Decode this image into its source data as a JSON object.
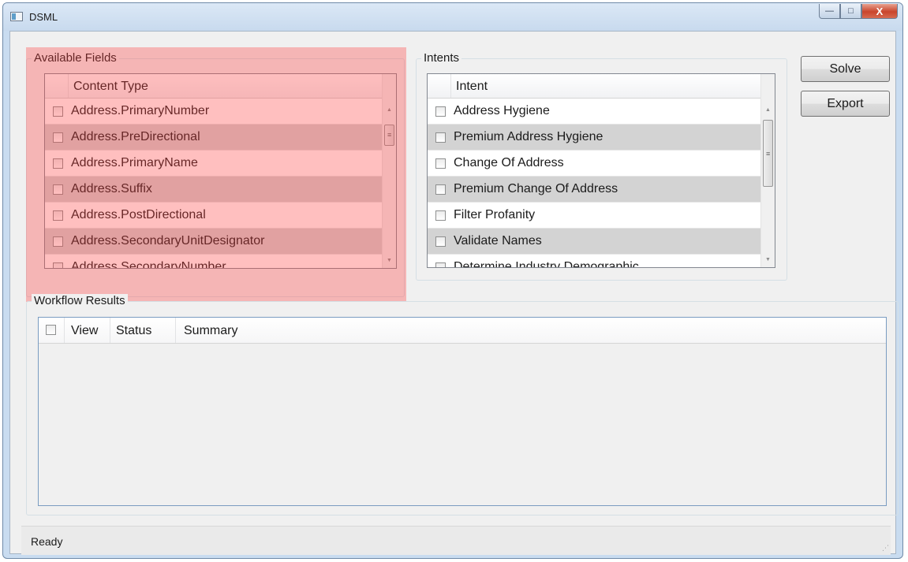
{
  "window": {
    "title": "DSML",
    "controls": {
      "minimize": "—",
      "maximize": "□",
      "close": "X"
    }
  },
  "available_fields": {
    "group_label": "Available Fields",
    "column_header": "Content Type",
    "highlight_color": "#ff3c3c",
    "rows": [
      {
        "label": "Address.PrimaryNumber",
        "checked": false
      },
      {
        "label": "Address.PreDirectional",
        "checked": false
      },
      {
        "label": "Address.PrimaryName",
        "checked": false
      },
      {
        "label": "Address.Suffix",
        "checked": false
      },
      {
        "label": "Address.PostDirectional",
        "checked": false
      },
      {
        "label": "Address.SecondaryUnitDesignator",
        "checked": false
      },
      {
        "label": "Address.SecondaryNumber",
        "checked": false
      }
    ]
  },
  "intents": {
    "group_label": "Intents",
    "column_header": "Intent",
    "rows": [
      {
        "label": "Address Hygiene",
        "checked": false
      },
      {
        "label": "Premium Address Hygiene",
        "checked": false
      },
      {
        "label": "Change Of Address",
        "checked": false
      },
      {
        "label": "Premium Change Of Address",
        "checked": false
      },
      {
        "label": "Filter Profanity",
        "checked": false
      },
      {
        "label": "Validate Names",
        "checked": false
      },
      {
        "label": "Determine Industry Demographic",
        "checked": false
      }
    ]
  },
  "buttons": {
    "solve": "Solve",
    "export": "Export"
  },
  "workflow_results": {
    "group_label": "Workflow Results",
    "columns": [
      "View",
      "Status",
      "Summary"
    ]
  },
  "status_bar": {
    "text": "Ready"
  }
}
